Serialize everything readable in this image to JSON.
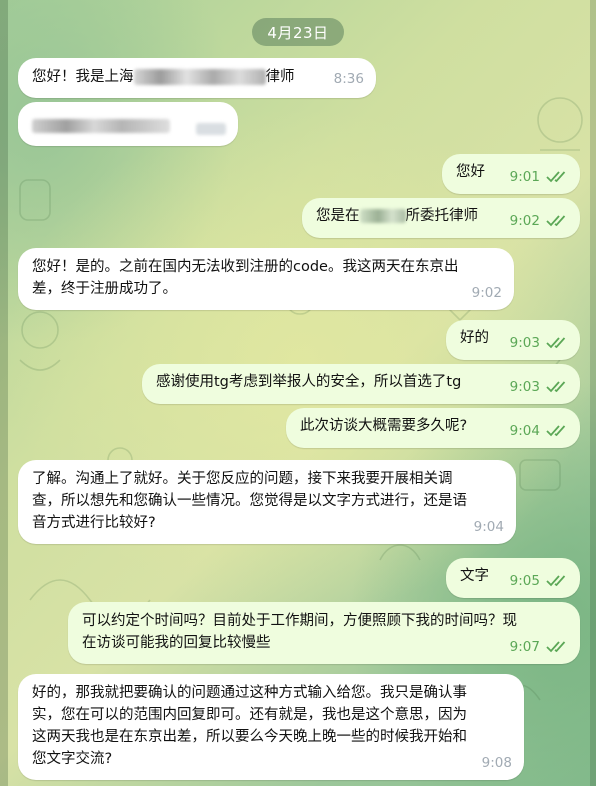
{
  "date_label": "4月23日",
  "messages": [
    {
      "dir": "in",
      "pre": "您好！我是上海",
      "post": "律师",
      "time": "8:36"
    },
    {
      "dir": "in",
      "redacted": true
    },
    {
      "dir": "out",
      "text": "您好",
      "time": "9:01"
    },
    {
      "dir": "out",
      "pre": "您是在",
      "post": "所委托律师",
      "time": "9:02"
    },
    {
      "dir": "in",
      "line1": "您好！是的。之前在国内无法收到注册的code。我这两天在东京出",
      "line2": "差，终于注册成功了。",
      "time": "9:02"
    },
    {
      "dir": "out",
      "text": "好的",
      "time": "9:03"
    },
    {
      "dir": "out",
      "text": "感谢使用tg考虑到举报人的安全，所以首选了tg",
      "time": "9:03"
    },
    {
      "dir": "out",
      "text": "此次访谈大概需要多久呢?",
      "time": "9:04"
    },
    {
      "dir": "in",
      "line1": "了解。沟通上了就好。关于您反应的问题，接下来我要开展相关调",
      "line2": "查，所以想先和您确认一些情况。您觉得是以文字方式进行，还是语",
      "line3": "音方式进行比较好?",
      "time": "9:04"
    },
    {
      "dir": "out",
      "text": "文字",
      "time": "9:05"
    },
    {
      "dir": "out",
      "line1": "可以约定个时间吗？目前处于工作期间，方便照顾下我的时间吗？现",
      "line2": "在访谈可能我的回复比较慢些",
      "time": "9:07"
    },
    {
      "dir": "in",
      "line1": "好的，那我就把要确认的问题通过这种方式输入给您。我只是确认事",
      "line2": "实，您在可以的范围内回复即可。还有就是，我也是这个意思，因为",
      "line3": "这两天我也是在东京出差，所以要么今天晚上晚一些的时候我开始和",
      "line4": "您文字交流?",
      "time": "9:08"
    }
  ],
  "colors": {
    "incoming": "#ffffff",
    "outgoing": "#effdde",
    "check": "#5ba756",
    "time_in": "#a1aab3"
  }
}
